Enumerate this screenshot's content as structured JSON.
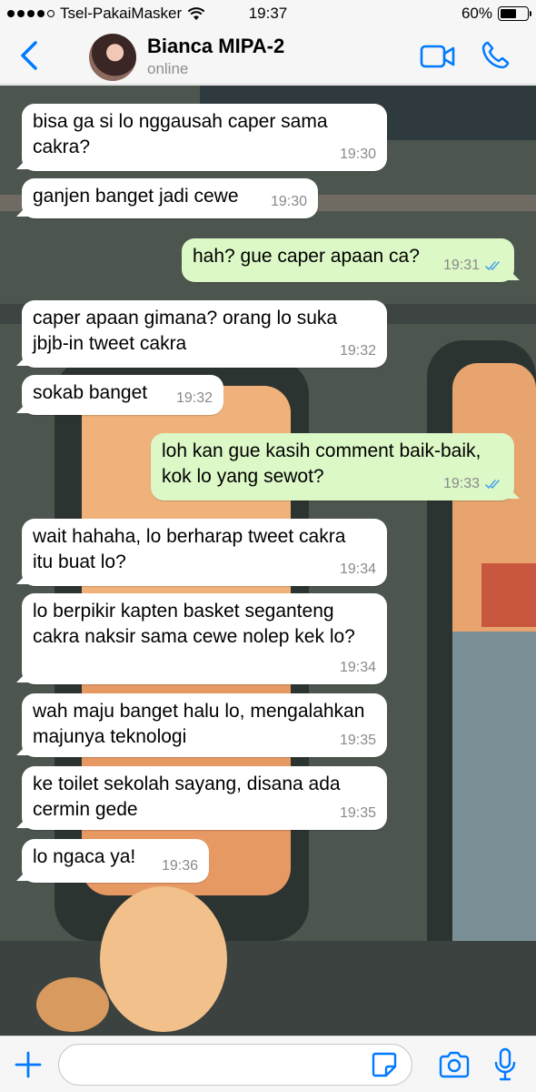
{
  "status_bar": {
    "carrier": "Tsel-PakaiMasker",
    "time": "19:37",
    "battery_text": "60%",
    "battery_level": 0.6,
    "signal_bars_filled": 4,
    "signal_bars_total": 5
  },
  "header": {
    "contact_name": "Bianca MIPA-2",
    "contact_status": "online",
    "icons": [
      "back-chevron-icon",
      "video-call-icon",
      "phone-call-icon"
    ],
    "accent_color": "#007aff"
  },
  "messages": [
    {
      "dir": "in",
      "lines": [
        "bisa ga si lo nggausah caper sama",
        "cakra?"
      ],
      "time": "19:30"
    },
    {
      "dir": "in",
      "lines": [
        "ganjen banget jadi cewe"
      ],
      "time": "19:30"
    },
    {
      "dir": "out",
      "lines": [
        "hah? gue caper apaan ca?"
      ],
      "time": "19:31",
      "read": true
    },
    {
      "dir": "in",
      "lines": [
        "caper apaan gimana? orang lo suka",
        "jbjb-in tweet cakra"
      ],
      "time": "19:32"
    },
    {
      "dir": "in",
      "lines": [
        "sokab banget"
      ],
      "time": "19:32"
    },
    {
      "dir": "out",
      "lines": [
        "loh kan gue kasih comment baik-baik,",
        "kok lo yang sewot?"
      ],
      "time": "19:33",
      "read": true
    },
    {
      "dir": "in",
      "lines": [
        "wait hahaha, lo berharap tweet cakra",
        "itu buat lo?"
      ],
      "time": "19:34"
    },
    {
      "dir": "in",
      "lines": [
        "lo berpikir kapten basket seganteng",
        "cakra naksir sama cewe nolep kek lo?"
      ],
      "time": "19:34"
    },
    {
      "dir": "in",
      "lines": [
        "wah maju banget halu lo, mengalahkan",
        "majunya teknologi"
      ],
      "time": "19:35"
    },
    {
      "dir": "in",
      "lines": [
        "ke toilet sekolah sayang, disana ada",
        "cermin gede"
      ],
      "time": "19:35"
    },
    {
      "dir": "in",
      "lines": [
        "lo ngaca ya!"
      ],
      "time": "19:36"
    }
  ],
  "input_bar": {
    "message_value": "",
    "icons": [
      "plus-icon",
      "sticker-icon",
      "camera-icon",
      "microphone-icon"
    ]
  },
  "colors": {
    "incoming_bubble": "#ffffff",
    "outgoing_bubble": "#dcf8c6",
    "read_ticks": "#4fa6e8"
  }
}
